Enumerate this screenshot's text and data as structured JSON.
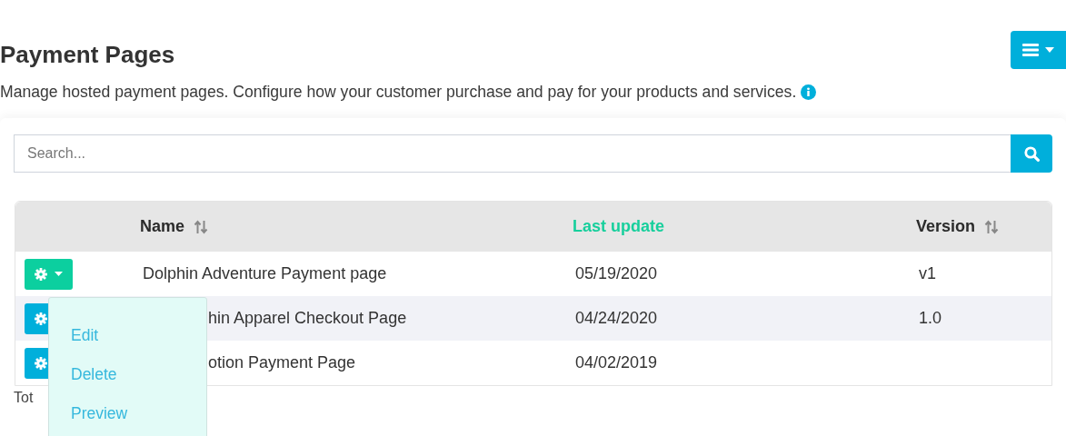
{
  "header": {
    "title": "Payment Pages",
    "description": "Manage hosted payment pages. Configure how your customer purchase and pay for your products and services."
  },
  "search": {
    "placeholder": "Search..."
  },
  "table": {
    "columns": [
      {
        "label": "Name",
        "sortable": true,
        "active": false
      },
      {
        "label": "Last update",
        "sortable": false,
        "active": true
      },
      {
        "label": "Version",
        "sortable": true,
        "active": false
      }
    ],
    "rows": [
      {
        "name": "Dolphin Adventure Payment page",
        "updated": "05/19/2020",
        "version": "v1",
        "menu_open": true
      },
      {
        "name": "hin Apparel Checkout Page",
        "updated": "04/24/2020",
        "version": "1.0",
        "menu_open": false
      },
      {
        "name": "otion Payment Page",
        "updated": "04/02/2019",
        "version": "",
        "menu_open": false
      }
    ]
  },
  "menu": {
    "items": [
      "Edit",
      "Delete",
      "Preview"
    ]
  },
  "footer": {
    "total": "Tot"
  }
}
